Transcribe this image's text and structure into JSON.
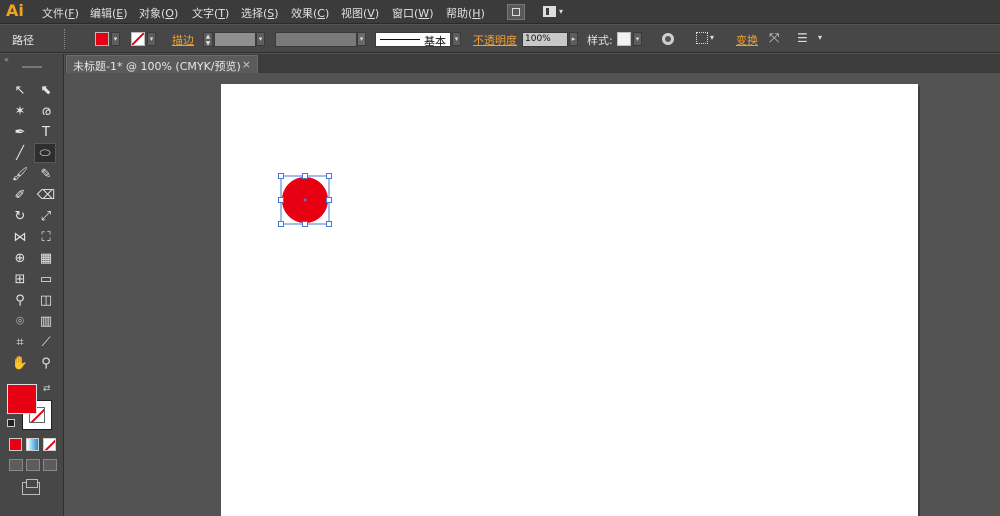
{
  "app": {
    "logo": "Ai"
  },
  "menu": [
    {
      "label": "文件(",
      "key": "F",
      "tail": ")"
    },
    {
      "label": "编辑(",
      "key": "E",
      "tail": ")"
    },
    {
      "label": "对象(",
      "key": "O",
      "tail": ")"
    },
    {
      "label": "文字(",
      "key": "T",
      "tail": ")"
    },
    {
      "label": "选择(",
      "key": "S",
      "tail": ")"
    },
    {
      "label": "效果(",
      "key": "C",
      "tail": ")"
    },
    {
      "label": "视图(",
      "key": "V",
      "tail": ")"
    },
    {
      "label": "窗口(",
      "key": "W",
      "tail": ")"
    },
    {
      "label": "帮助(",
      "key": "H",
      "tail": ")"
    }
  ],
  "control": {
    "object_type": "路径",
    "stroke_label": "描边",
    "stroke_profile": "基本",
    "opacity_label": "不透明度",
    "opacity_value": "100%",
    "style_label": "样式:",
    "transform_label": "变换"
  },
  "document": {
    "tab_title": "未标题-1* @ 100% (CMYK/预览)",
    "close_glyph": "×"
  },
  "colors": {
    "fill": "#e60012",
    "orange": "#f0a030"
  }
}
